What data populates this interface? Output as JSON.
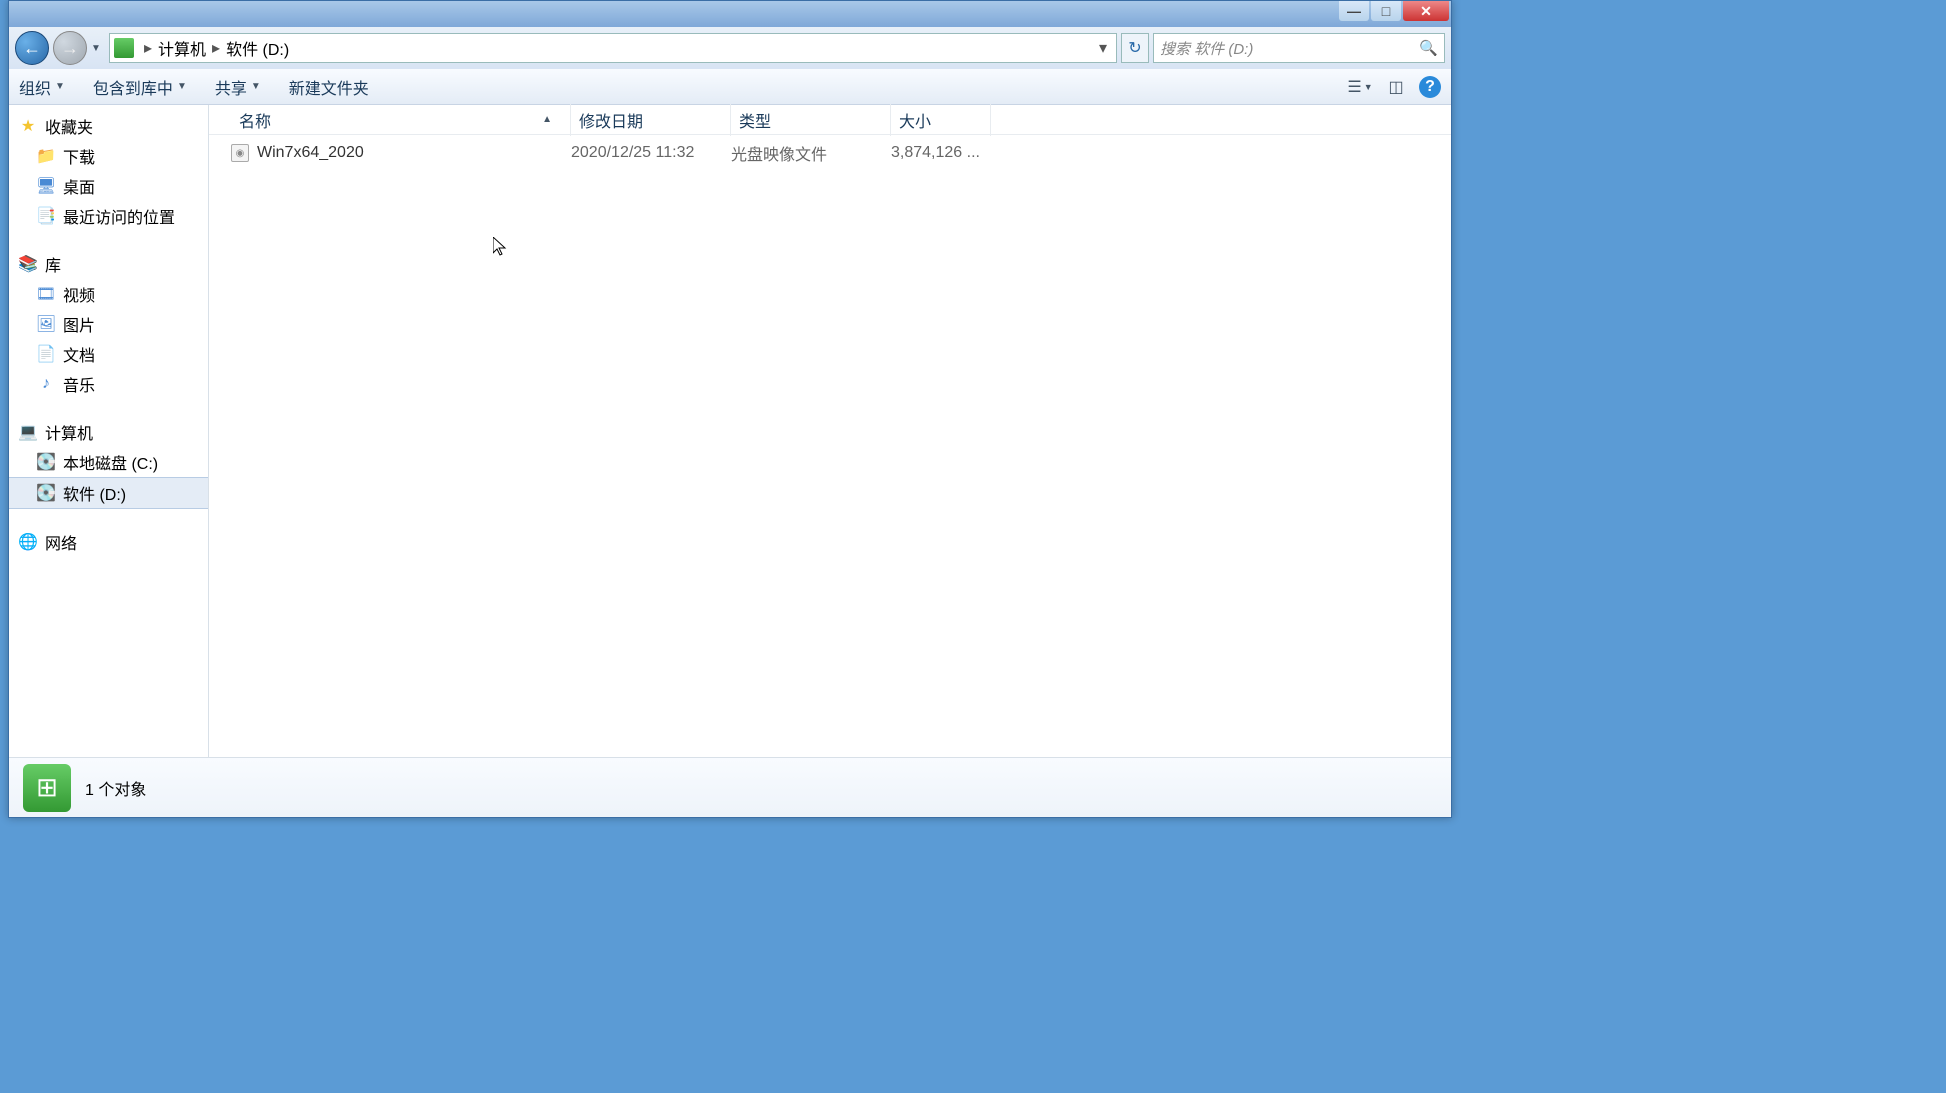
{
  "breadcrumb": {
    "parts": [
      "计算机",
      "软件 (D:)"
    ]
  },
  "search": {
    "placeholder": "搜索 软件 (D:)"
  },
  "toolbar": {
    "organize": "组织",
    "include": "包含到库中",
    "share": "共享",
    "newfolder": "新建文件夹"
  },
  "columns": {
    "name": "名称",
    "date": "修改日期",
    "type": "类型",
    "size": "大小"
  },
  "files": [
    {
      "name": "Win7x64_2020",
      "date": "2020/12/25 11:32",
      "type": "光盘映像文件",
      "size": "3,874,126 ..."
    }
  ],
  "sidebar": {
    "favorites": "收藏夹",
    "downloads": "下载",
    "desktop": "桌面",
    "recent": "最近访问的位置",
    "libraries": "库",
    "videos": "视频",
    "pictures": "图片",
    "documents": "文档",
    "music": "音乐",
    "computer": "计算机",
    "local_c": "本地磁盘 (C:)",
    "soft_d": "软件 (D:)",
    "network": "网络"
  },
  "status": {
    "count": "1 个对象"
  }
}
